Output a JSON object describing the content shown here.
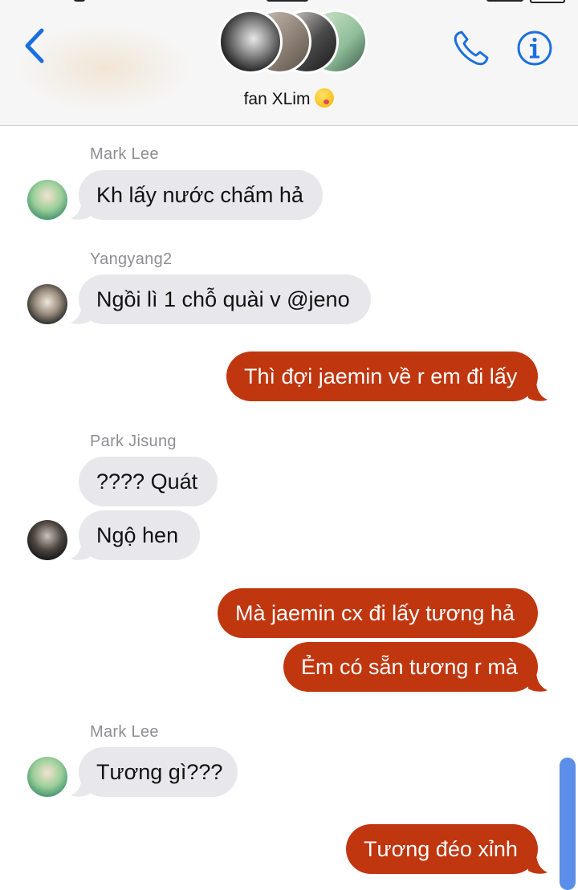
{
  "header": {
    "group_name": "fan XLim",
    "emoji": "face-savoring-food"
  },
  "messages": [
    {
      "sender": "Mark Lee",
      "text": "Kh lấy nước chấm hả"
    },
    {
      "sender": "Yangyang2",
      "text": "Ngồi lì 1 chỗ quài v @jeno"
    },
    {
      "text": "Thì đợi jaemin về r em đi lấy"
    },
    {
      "sender": "Park Jisung",
      "text": "???? Quát"
    },
    {
      "text": "Ngộ hen"
    },
    {
      "text": "Mà jaemin cx đi lấy tương hả"
    },
    {
      "text": "Ẻm có sẵn tương r mà"
    },
    {
      "sender": "Mark Lee",
      "text": "Tương gì???"
    },
    {
      "text": "Tương đéo xỉnh"
    }
  ],
  "colors": {
    "accent": "#1a6fe0",
    "outgoing_bubble": "#c0360f",
    "incoming_bubble": "#e8e8ec",
    "sender_name": "#8e8e93"
  }
}
